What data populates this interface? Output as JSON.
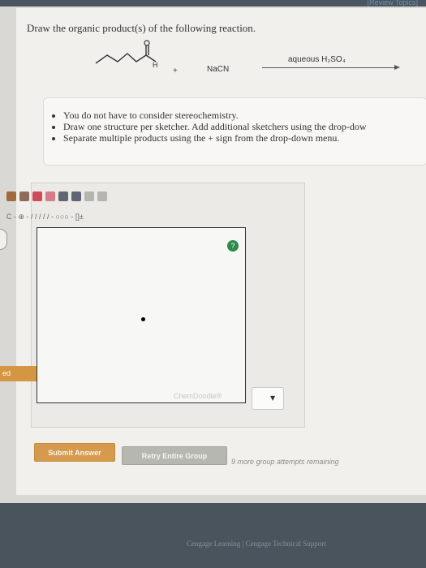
{
  "header": {
    "review_link": "[Review Topics]"
  },
  "question": {
    "prompt": "Draw the organic product(s) of the following reaction.",
    "reagent": "NaCN",
    "plus": "+",
    "conditions": "aqueous H₂SO₄"
  },
  "instructions": [
    "You do not have to consider stereochemistry.",
    "Draw one structure per sketcher. Add additional sketchers using the drop-dow",
    "Separate multiple products using the + sign from the drop-down menu."
  ],
  "sketcher": {
    "toolbar_row1": [
      "back-icon",
      "hand-icon",
      "lasso-icon",
      "eraser-icon",
      "zoom-in-icon",
      "zoom-out-icon",
      "template-icon",
      "settings-icon"
    ],
    "toolbar_row2_text": "C - ⊕ - / / / / / - ○○○ - []±",
    "chemdoodle_label": "ChemDoodle®"
  },
  "buttons": {
    "submit": "Submit Answer",
    "retry": "Retry Entire Group"
  },
  "attempts_text": "9 more group attempts remaining",
  "left_tab": "ed",
  "footer": {
    "text": "Cengage Learning | Cengage Technical Support"
  },
  "colors": {
    "accent_orange": "#d69a4e",
    "help_green": "#2d8a4a",
    "footer_bg": "#4a545c"
  }
}
